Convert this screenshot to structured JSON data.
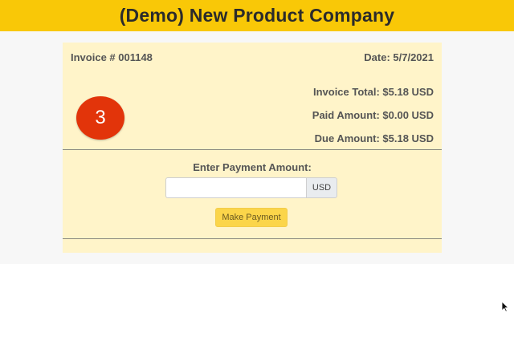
{
  "header": {
    "title": "(Demo) New Product Company"
  },
  "invoice": {
    "number_label": "Invoice # 001148",
    "date_label": "Date: 5/7/2021",
    "total_label": "Invoice Total: $5.18 USD",
    "paid_label": "Paid Amount: $0.00 USD",
    "due_label": "Due Amount: $5.18 USD",
    "badge_text": "3"
  },
  "payment": {
    "prompt_label": "Enter Payment Amount:",
    "amount_value": "",
    "amount_placeholder": "",
    "currency": "USD",
    "button_label": "Make Payment"
  },
  "colors": {
    "header_bg": "#f9c807",
    "card_bg": "#fff4c9",
    "badge_bg": "#e2340a",
    "button_bg": "#fbd54a"
  },
  "icons": {
    "cursor": "mouse-pointer-icon"
  }
}
